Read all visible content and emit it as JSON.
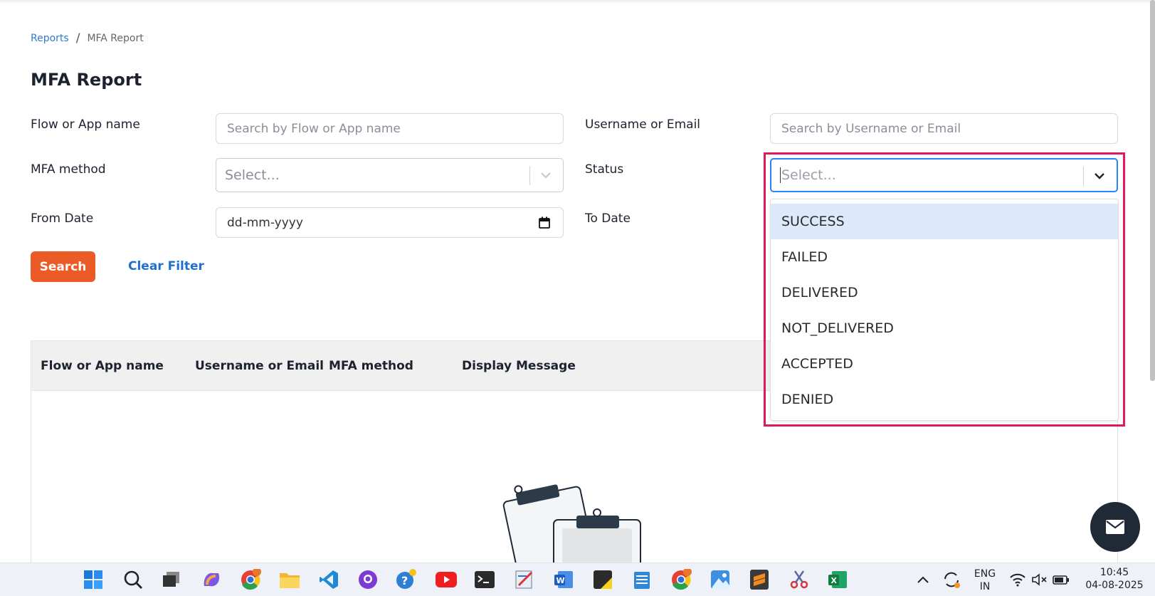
{
  "breadcrumb": {
    "parent": "Reports",
    "separator": "/",
    "current": "MFA Report"
  },
  "page_title": "MFA Report",
  "filters": {
    "flow_label": "Flow or App name",
    "flow_placeholder": "Search by Flow or App name",
    "user_label": "Username or Email",
    "user_placeholder": "Search by Username or Email",
    "mfa_label": "MFA method",
    "mfa_placeholder": "Select...",
    "status_label": "Status",
    "status_placeholder": "Select...",
    "from_label": "From Date",
    "from_value": "dd-mm-yyyy",
    "to_label": "To Date"
  },
  "actions": {
    "search": "Search",
    "clear": "Clear Filter"
  },
  "table": {
    "headers": [
      "Flow or App name",
      "Username or Email",
      "MFA method",
      "Display Message"
    ]
  },
  "status_options": [
    "SUCCESS",
    "FAILED",
    "DELIVERED",
    "NOT_DELIVERED",
    "ACCEPTED",
    "DENIED"
  ],
  "taskbar": {
    "lang_top": "ENG",
    "lang_bottom": "IN",
    "time": "10:45",
    "date": "04-08-2025",
    "icons": [
      "windows-start-icon",
      "search-icon",
      "task-view-icon",
      "copilot-icon",
      "chrome-icon",
      "file-explorer-icon",
      "vscode-icon",
      "github-desktop-icon",
      "help-icon",
      "youtube-icon",
      "terminal-icon",
      "paint-icon",
      "word-icon",
      "sticky-notes-icon",
      "notepad-icon",
      "chrome-profile-icon",
      "photos-icon",
      "sublime-icon",
      "snipping-tool-icon",
      "excel-icon"
    ]
  },
  "colors": {
    "accent": "#ec5a26",
    "link": "#1f6fd0",
    "highlight": "#e0195f",
    "option_active": "#dbe9fb"
  }
}
